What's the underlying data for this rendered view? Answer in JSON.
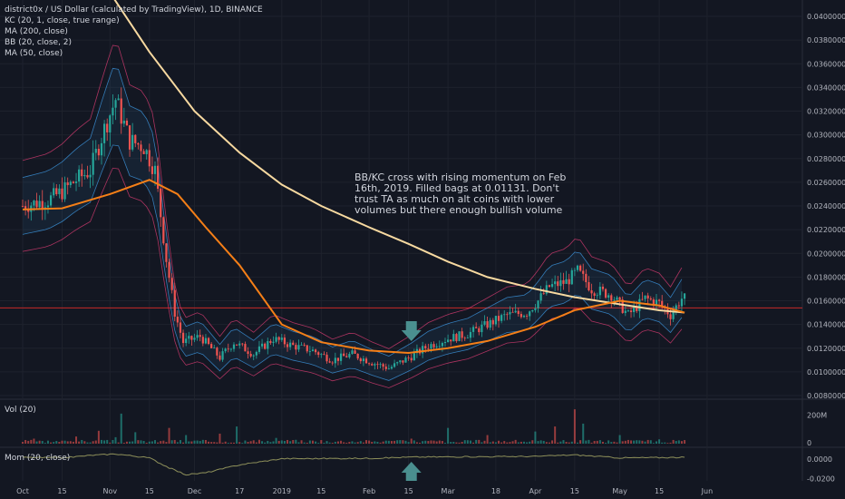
{
  "legend": {
    "title": "district0x / US Dollar (calculated by TradingView), 1D, BINANCE",
    "kc": "KC (20, 1, close, true range)",
    "ma200": "MA (200, close)",
    "bb": "BB (20, close, 2)",
    "ma50": "MA (50, close)"
  },
  "annotation": "BB/KC cross with rising momentum on Feb 16th, 2019. Filled bags at 0.01131. Don't trust TA as much on alt coins with lower volumes but there enough bullish volume",
  "panes": {
    "volume_label": "Vol (20)",
    "momentum_label": "Mom (20, close)"
  },
  "colors": {
    "background": "#131722",
    "up": "#26a69a",
    "down": "#ef5350",
    "ma200": "#f7d9a0",
    "ma50": "#f57f17",
    "bb": "#ec407a",
    "kc": "#42a5f5",
    "momentum": "#8d8f5a",
    "arrow": "#4a8f8f",
    "resistance": "#c62828"
  },
  "chart_data": [
    {
      "type": "candlestick",
      "title": "district0x / US Dollar (calculated by TradingView), 1D, BINANCE",
      "x_ticks": [
        "Oct",
        "15",
        "Nov",
        "15",
        "Dec",
        "17",
        "2019",
        "15",
        "Feb",
        "15",
        "Mar",
        "18",
        "Apr",
        "15",
        "May",
        "15",
        "Jun"
      ],
      "y_ticks": [
        "0.04000000",
        "0.03800000",
        "0.03600000",
        "0.03400000",
        "0.03200000",
        "0.03000000",
        "0.02800000",
        "0.02600000",
        "0.02400000",
        "0.02200000",
        "0.02000000",
        "0.01800000",
        "0.01600000",
        "0.01400000",
        "0.01200000",
        "0.01000000",
        "0.00800000"
      ],
      "ylim": [
        0.008,
        0.04
      ],
      "horizontal_line": 0.0154,
      "close_series": [
        [
          "2018-10-01",
          0.024
        ],
        [
          "2018-10-10",
          0.0245
        ],
        [
          "2018-10-15",
          0.0252
        ],
        [
          "2018-10-20",
          0.0262
        ],
        [
          "2018-10-25",
          0.027
        ],
        [
          "2018-10-30",
          0.0305
        ],
        [
          "2018-11-03",
          0.033
        ],
        [
          "2018-11-08",
          0.0295
        ],
        [
          "2018-11-13",
          0.029
        ],
        [
          "2018-11-17",
          0.027
        ],
        [
          "2018-11-21",
          0.0195
        ],
        [
          "2018-11-24",
          0.015
        ],
        [
          "2018-11-27",
          0.0125
        ],
        [
          "2018-12-03",
          0.013
        ],
        [
          "2018-12-10",
          0.0112
        ],
        [
          "2018-12-15",
          0.0125
        ],
        [
          "2018-12-22",
          0.0115
        ],
        [
          "2018-12-29",
          0.0128
        ],
        [
          "2019-01-05",
          0.0122
        ],
        [
          "2019-01-12",
          0.0118
        ],
        [
          "2019-01-19",
          0.011
        ],
        [
          "2019-01-26",
          0.0115
        ],
        [
          "2019-02-02",
          0.0108
        ],
        [
          "2019-02-08",
          0.0103
        ],
        [
          "2019-02-16",
          0.0113
        ],
        [
          "2019-02-22",
          0.0122
        ],
        [
          "2019-03-01",
          0.0128
        ],
        [
          "2019-03-08",
          0.0132
        ],
        [
          "2019-03-15",
          0.014
        ],
        [
          "2019-03-22",
          0.0148
        ],
        [
          "2019-03-29",
          0.015
        ],
        [
          "2019-04-02",
          0.016
        ],
        [
          "2019-04-06",
          0.0172
        ],
        [
          "2019-04-12",
          0.0176
        ],
        [
          "2019-04-16",
          0.0185
        ],
        [
          "2019-04-21",
          0.017
        ],
        [
          "2019-04-28",
          0.0165
        ],
        [
          "2019-05-04",
          0.0148
        ],
        [
          "2019-05-10",
          0.0162
        ],
        [
          "2019-05-15",
          0.0158
        ],
        [
          "2019-05-19",
          0.0148
        ],
        [
          "2019-05-23",
          0.0162
        ]
      ],
      "ma200": [
        [
          "2018-10-01",
          0.046
        ],
        [
          "2018-11-01",
          0.042
        ],
        [
          "2018-11-15",
          0.037
        ],
        [
          "2018-12-01",
          0.032
        ],
        [
          "2018-12-17",
          0.0285
        ],
        [
          "2019-01-01",
          0.0258
        ],
        [
          "2019-01-15",
          0.024
        ],
        [
          "2019-02-01",
          0.0222
        ],
        [
          "2019-02-15",
          0.0208
        ],
        [
          "2019-03-01",
          0.0193
        ],
        [
          "2019-03-15",
          0.018
        ],
        [
          "2019-04-01",
          0.017
        ],
        [
          "2019-04-15",
          0.0163
        ],
        [
          "2019-05-01",
          0.0157
        ],
        [
          "2019-05-15",
          0.0152
        ],
        [
          "2019-05-24",
          0.015
        ]
      ],
      "ma50": [
        [
          "2018-10-01",
          0.0237
        ],
        [
          "2018-10-15",
          0.0238
        ],
        [
          "2018-11-01",
          0.025
        ],
        [
          "2018-11-15",
          0.0262
        ],
        [
          "2018-11-25",
          0.025
        ],
        [
          "2018-12-05",
          0.0222
        ],
        [
          "2018-12-17",
          0.019
        ],
        [
          "2019-01-01",
          0.014
        ],
        [
          "2019-01-15",
          0.0125
        ],
        [
          "2019-02-01",
          0.0118
        ],
        [
          "2019-02-15",
          0.0116
        ],
        [
          "2019-03-01",
          0.012
        ],
        [
          "2019-03-15",
          0.0126
        ],
        [
          "2019-04-01",
          0.0138
        ],
        [
          "2019-04-15",
          0.0152
        ],
        [
          "2019-05-01",
          0.016
        ],
        [
          "2019-05-15",
          0.0156
        ],
        [
          "2019-05-24",
          0.015
        ]
      ],
      "annotation_arrow_date": "2019-02-16"
    },
    {
      "type": "bar",
      "title": "Vol (20)",
      "y_ticks": [
        "200M",
        "0"
      ],
      "values_M": [
        [
          "2018-10-05",
          35
        ],
        [
          "2018-10-20",
          50
        ],
        [
          "2018-10-28",
          90
        ],
        [
          "2018-11-03",
          45
        ],
        [
          "2018-11-05",
          210
        ],
        [
          "2018-11-10",
          80
        ],
        [
          "2018-11-22",
          110
        ],
        [
          "2018-11-28",
          60
        ],
        [
          "2018-12-10",
          70
        ],
        [
          "2018-12-16",
          120
        ],
        [
          "2018-12-30",
          40
        ],
        [
          "2019-01-15",
          25
        ],
        [
          "2019-02-08",
          20
        ],
        [
          "2019-02-16",
          35
        ],
        [
          "2019-03-01",
          110
        ],
        [
          "2019-03-15",
          60
        ],
        [
          "2019-04-01",
          85
        ],
        [
          "2019-04-08",
          120
        ],
        [
          "2019-04-15",
          240
        ],
        [
          "2019-04-18",
          140
        ],
        [
          "2019-05-01",
          60
        ],
        [
          "2019-05-15",
          30
        ]
      ]
    },
    {
      "type": "line",
      "title": "Mom (20, close)",
      "y_ticks": [
        "0.0000",
        "-0.0200"
      ],
      "values": [
        [
          "2018-10-01",
          0.0015
        ],
        [
          "2018-10-15",
          0.001
        ],
        [
          "2018-10-25",
          0.0035
        ],
        [
          "2018-11-03",
          0.005
        ],
        [
          "2018-11-15",
          0.001
        ],
        [
          "2018-11-22",
          -0.009
        ],
        [
          "2018-11-28",
          -0.016
        ],
        [
          "2018-12-05",
          -0.014
        ],
        [
          "2018-12-17",
          -0.006
        ],
        [
          "2019-01-01",
          0.0002
        ],
        [
          "2019-02-01",
          0.0005
        ],
        [
          "2019-02-16",
          0.0018
        ],
        [
          "2019-03-01",
          0.002
        ],
        [
          "2019-04-01",
          0.0025
        ],
        [
          "2019-04-15",
          0.004
        ],
        [
          "2019-05-01",
          0.001
        ],
        [
          "2019-05-24",
          0.0015
        ]
      ]
    }
  ]
}
